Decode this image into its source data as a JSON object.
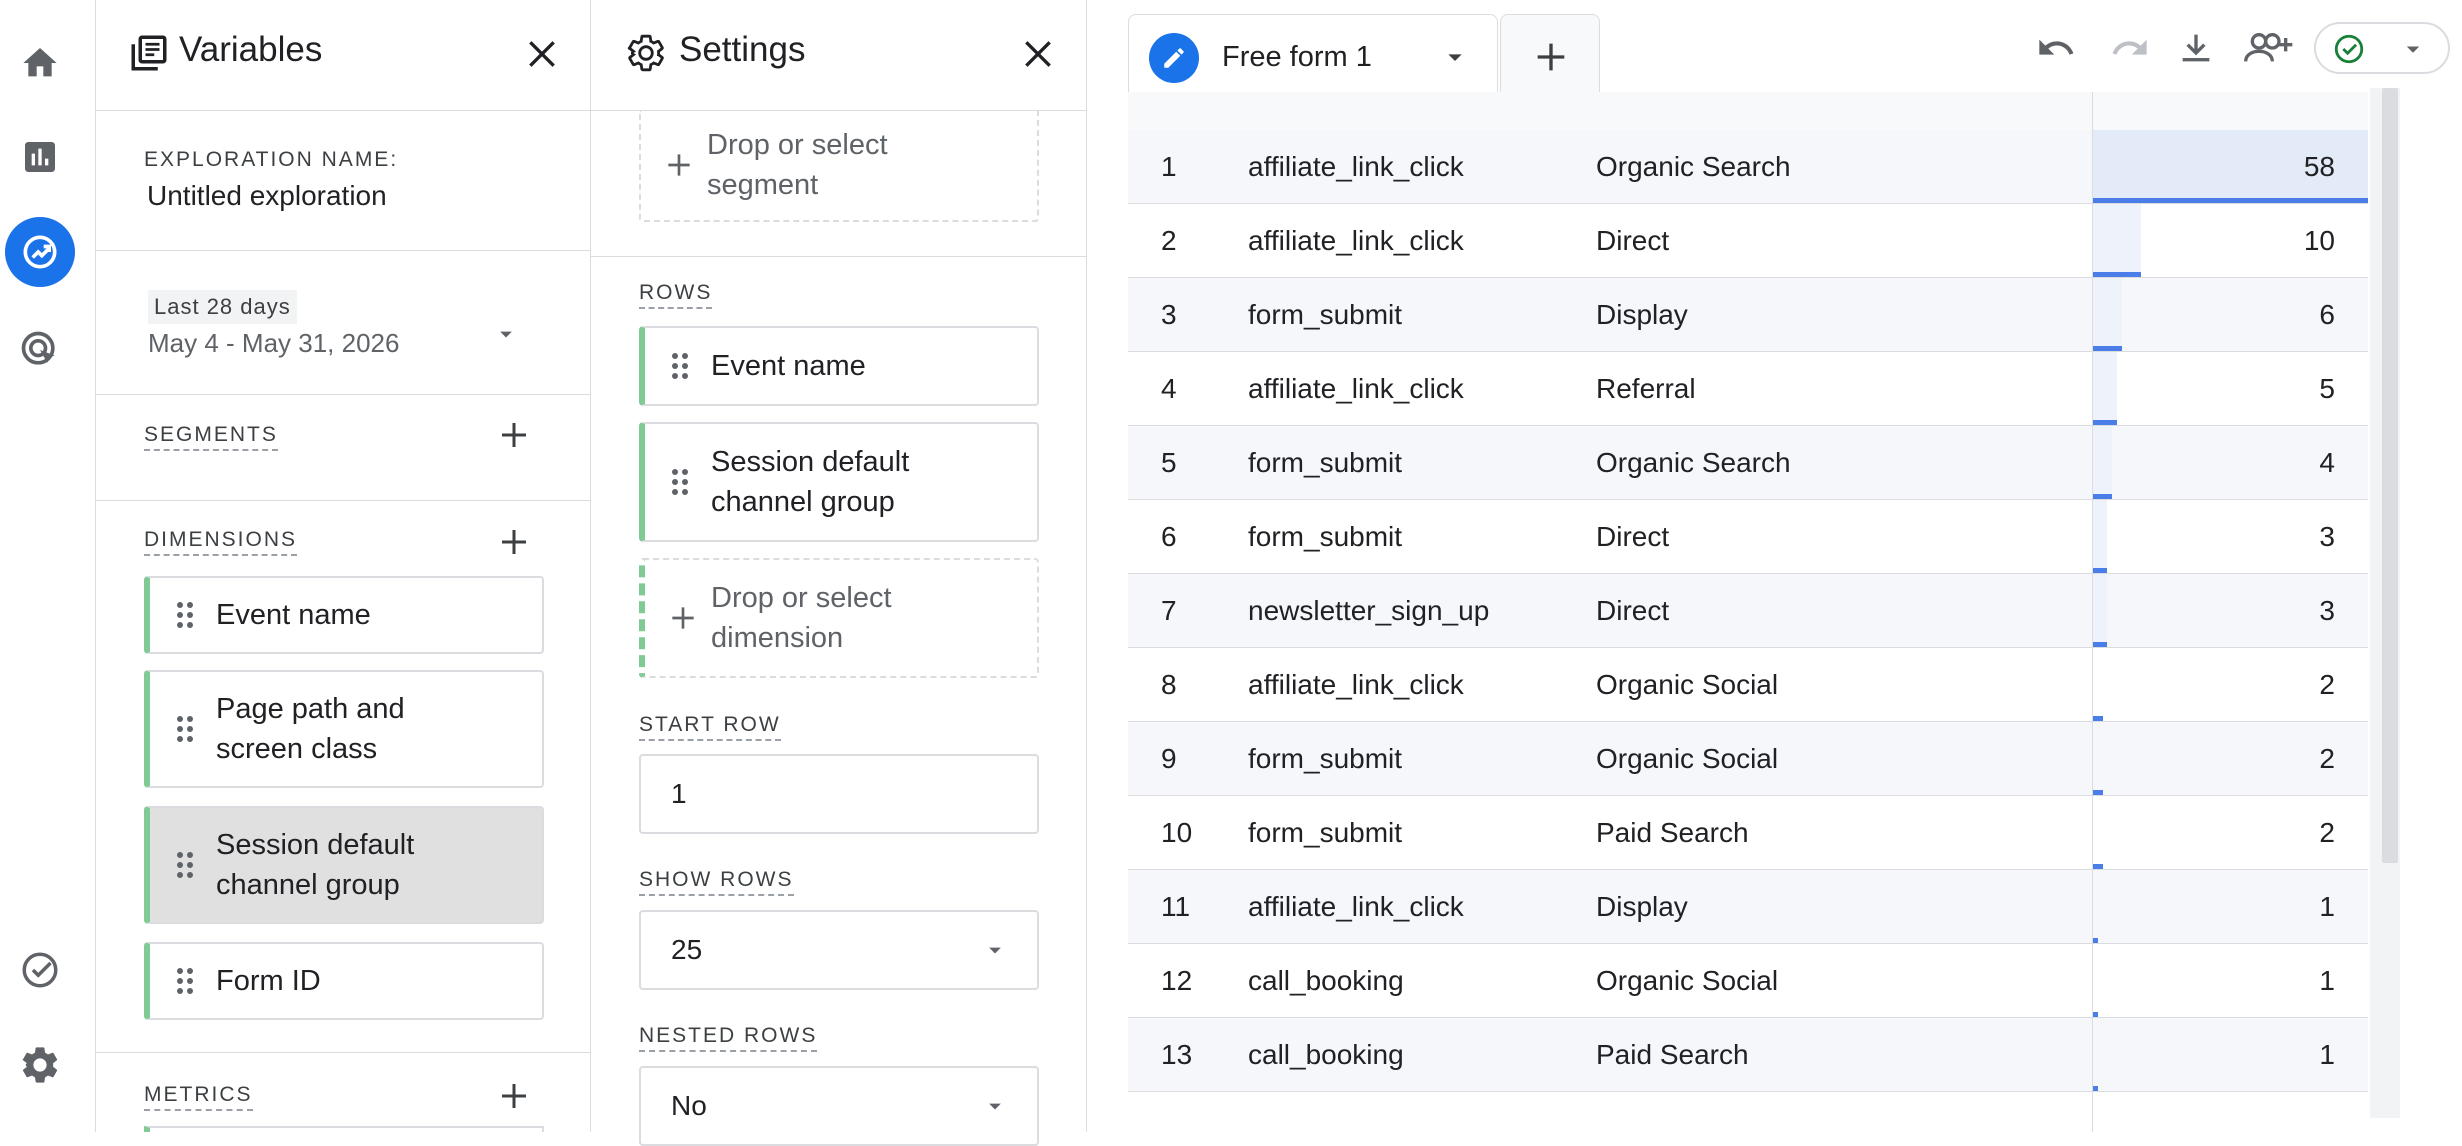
{
  "rail": {
    "items": [
      {
        "name": "home-icon"
      },
      {
        "name": "reports-icon"
      },
      {
        "name": "explore-icon",
        "active": true
      },
      {
        "name": "advertising-icon"
      },
      {
        "name": "admin-check-icon"
      },
      {
        "name": "settings-gear-icon"
      }
    ]
  },
  "variables": {
    "title": "Variables",
    "exploration_name_label": "EXPLORATION NAME:",
    "exploration_name_value": "Untitled exploration",
    "date_badge": "Last 28 days",
    "date_range": "May 4 - May 31, 2026",
    "segments_label": "SEGMENTS",
    "dimensions_label": "DIMENSIONS",
    "dimensions": [
      {
        "label": "Event name"
      },
      {
        "label": "Page path and\nscreen class"
      },
      {
        "label": "Session default\nchannel group",
        "selected": true
      },
      {
        "label": "Form ID"
      }
    ],
    "metrics_label": "METRICS"
  },
  "settings": {
    "title": "Settings",
    "segment_drop": "Drop or select\nsegment",
    "rows_label": "ROWS",
    "rows": [
      {
        "label": "Event name"
      },
      {
        "label": "Session default\nchannel group"
      }
    ],
    "dimension_drop": "Drop or select\ndimension",
    "start_row_label": "START ROW",
    "start_row_value": "1",
    "show_rows_label": "SHOW ROWS",
    "show_rows_value": "25",
    "nested_rows_label": "NESTED ROWS",
    "nested_rows_value": "No"
  },
  "tabs": {
    "active_label": "Free form 1",
    "add_label": "+"
  },
  "toolbar": {
    "icons": [
      "undo-icon",
      "redo-icon",
      "download-icon",
      "share-user-icon",
      "status-check-icon"
    ]
  },
  "colors": {
    "accent": "#1a73e8",
    "chip_border_green": "#81c995",
    "bar_blue": "#4a7de8",
    "bar_fill": "#e3eaf8"
  },
  "table": {
    "max_value": 58,
    "rows": [
      {
        "idx": "1",
        "event": "affiliate_link_click",
        "channel": "Organic Search",
        "value": 58
      },
      {
        "idx": "2",
        "event": "affiliate_link_click",
        "channel": "Direct",
        "value": 10
      },
      {
        "idx": "3",
        "event": "form_submit",
        "channel": "Display",
        "value": 6
      },
      {
        "idx": "4",
        "event": "affiliate_link_click",
        "channel": "Referral",
        "value": 5
      },
      {
        "idx": "5",
        "event": "form_submit",
        "channel": "Organic Search",
        "value": 4
      },
      {
        "idx": "6",
        "event": "form_submit",
        "channel": "Direct",
        "value": 3
      },
      {
        "idx": "7",
        "event": "newsletter_sign_up",
        "channel": "Direct",
        "value": 3
      },
      {
        "idx": "8",
        "event": "affiliate_link_click",
        "channel": "Organic Social",
        "value": 2
      },
      {
        "idx": "9",
        "event": "form_submit",
        "channel": "Organic Social",
        "value": 2
      },
      {
        "idx": "10",
        "event": "form_submit",
        "channel": "Paid Search",
        "value": 2
      },
      {
        "idx": "11",
        "event": "affiliate_link_click",
        "channel": "Display",
        "value": 1
      },
      {
        "idx": "12",
        "event": "call_booking",
        "channel": "Organic Social",
        "value": 1
      },
      {
        "idx": "13",
        "event": "call_booking",
        "channel": "Paid Search",
        "value": 1
      }
    ]
  }
}
